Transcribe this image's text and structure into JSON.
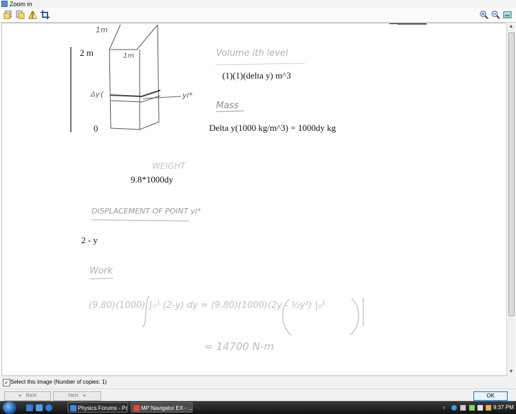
{
  "window": {
    "title": "Zoom in"
  },
  "document": {
    "label_2m": "2 m",
    "label_0": "0",
    "volume_text": "(1)(1)(delta y) m^3",
    "mass_text": "Delta y(1000 kg/m^3) = 1000dy kg",
    "weight_text": "9.8*1000dy",
    "displacement_text": "2 - y",
    "handwritten": {
      "dim_1m_top": "1m",
      "dim_1m_bottom": "1m",
      "delta_y": "Δy{",
      "yi_star": "yi*",
      "volume_heading": "Volume ith level",
      "mass_heading": "Mass",
      "weight_heading": "WEIGHT",
      "displacement_heading": "DISPLACEMENT OF POINT yi*",
      "work_heading": "Work",
      "work_integral": "(9.80)(1000) ∫₀¹ (2-y) dy = (9.80)(1000)(2y - ½y²) |₀¹",
      "work_result": "= 14700 N-m"
    }
  },
  "bottom": {
    "select_label": "Select this image (Number of copies: 1)",
    "back_label": "Back",
    "next_label": "Next",
    "ok_label": "OK"
  },
  "taskbar": {
    "tasks": [
      "Physics Forums - Po...",
      "MP Navigator EX - ..."
    ],
    "clock": "9:37 PM"
  },
  "colors": {
    "ok_border": "#3c7fb1",
    "taskbar": "#1a1a1a",
    "sketch": "#555555",
    "faint": "#b0b0b0"
  }
}
